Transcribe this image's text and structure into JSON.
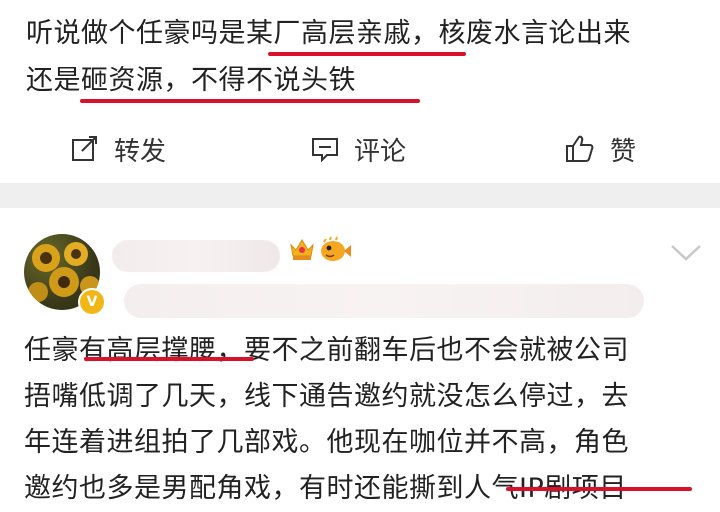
{
  "post1": {
    "line1": "听说做个任豪吗是某厂高层亲戚，核废水言论出来",
    "line2": "还是砸资源，不得不说头铁",
    "actions": {
      "repost": "转发",
      "comment": "评论",
      "like": "赞"
    }
  },
  "post2": {
    "line1": "任豪有高层撑腰，要不之前翻车后也不会就被公司",
    "line2": "捂嘴低调了几天，线下通告邀约就没怎么停过，去",
    "line3": "年连着进组拍了几部戏。他现在咖位并不高，角色",
    "line4": "邀约也多是男配角戏，有时还能撕到人气IP剧项目",
    "badge": "V"
  },
  "colors": {
    "underline": "#d8122a",
    "separator": "#efefef",
    "verified": "#f3b617"
  }
}
